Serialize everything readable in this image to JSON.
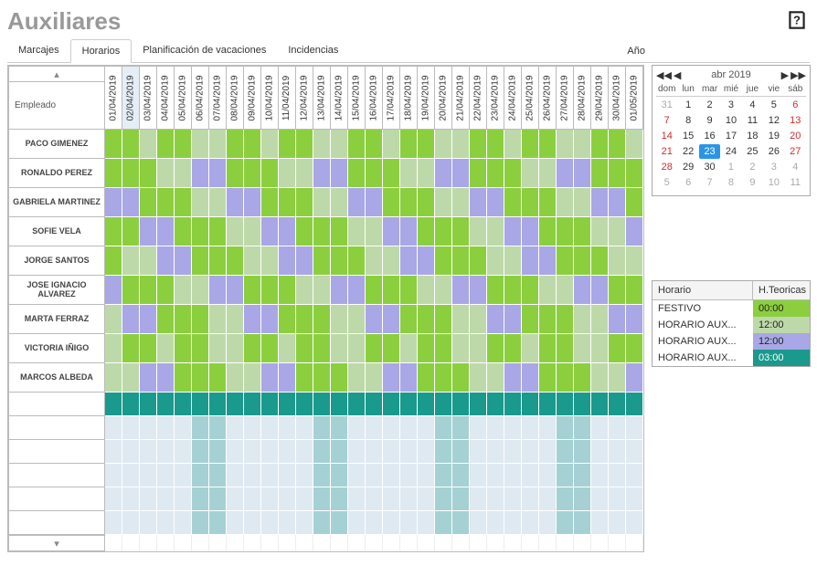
{
  "title": "Auxiliares",
  "year_label": "Año",
  "tabs": [
    "Marcajes",
    "Horarios",
    "Planificación de vacaciones",
    "Incidencias"
  ],
  "active_tab": 1,
  "employee_header": "Empleado",
  "dates": [
    "01/04/2019",
    "02/04/2019",
    "03/04/2019",
    "04/04/2019",
    "05/04/2019",
    "06/04/2019",
    "07/04/2019",
    "08/04/2019",
    "09/04/2019",
    "10/04/2019",
    "11/04/2019",
    "12/04/2019",
    "13/04/2019",
    "14/04/2019",
    "15/04/2019",
    "16/04/2019",
    "17/04/2019",
    "18/04/2019",
    "19/04/2019",
    "20/04/2019",
    "21/04/2019",
    "22/04/2019",
    "23/04/2019",
    "24/04/2019",
    "25/04/2019",
    "26/04/2019",
    "27/04/2019",
    "28/04/2019",
    "29/04/2019",
    "30/04/2019",
    "01/05/2019"
  ],
  "today_index": 1,
  "employees": [
    {
      "name": "PACO GIMENEZ",
      "cells": [
        "g",
        "g",
        "l",
        "g",
        "g",
        "l",
        "l",
        "g",
        "g",
        "l",
        "g",
        "g",
        "l",
        "l",
        "g",
        "g",
        "l",
        "g",
        "g",
        "l",
        "l",
        "g",
        "g",
        "l",
        "g",
        "g",
        "l",
        "l",
        "g",
        "g",
        "l"
      ]
    },
    {
      "name": "RONALDO PEREZ",
      "cells": [
        "g",
        "g",
        "g",
        "l",
        "l",
        "p",
        "p",
        "g",
        "g",
        "g",
        "l",
        "l",
        "p",
        "p",
        "g",
        "g",
        "g",
        "l",
        "l",
        "p",
        "p",
        "g",
        "g",
        "g",
        "l",
        "l",
        "p",
        "p",
        "g",
        "g",
        "g"
      ]
    },
    {
      "name": "GABRIELA MARTINEZ",
      "cells": [
        "p",
        "p",
        "g",
        "g",
        "g",
        "l",
        "l",
        "p",
        "p",
        "g",
        "g",
        "g",
        "l",
        "l",
        "p",
        "p",
        "g",
        "g",
        "g",
        "l",
        "l",
        "p",
        "p",
        "g",
        "g",
        "g",
        "l",
        "l",
        "p",
        "p",
        "g"
      ]
    },
    {
      "name": "SOFIE VELA",
      "cells": [
        "g",
        "g",
        "p",
        "p",
        "g",
        "g",
        "g",
        "l",
        "l",
        "p",
        "p",
        "g",
        "g",
        "g",
        "l",
        "l",
        "p",
        "p",
        "g",
        "g",
        "g",
        "l",
        "l",
        "p",
        "p",
        "g",
        "g",
        "g",
        "l",
        "l",
        "p"
      ]
    },
    {
      "name": "JORGE SANTOS",
      "cells": [
        "g",
        "l",
        "l",
        "p",
        "p",
        "g",
        "g",
        "g",
        "l",
        "l",
        "p",
        "p",
        "g",
        "g",
        "g",
        "l",
        "l",
        "p",
        "p",
        "g",
        "g",
        "g",
        "l",
        "l",
        "p",
        "p",
        "g",
        "g",
        "g",
        "l",
        "l"
      ]
    },
    {
      "name": "JOSE IGNACIO ALVAREZ",
      "cells": [
        "p",
        "g",
        "g",
        "g",
        "l",
        "l",
        "p",
        "p",
        "g",
        "g",
        "g",
        "l",
        "l",
        "p",
        "p",
        "g",
        "g",
        "g",
        "l",
        "l",
        "p",
        "p",
        "g",
        "g",
        "g",
        "l",
        "l",
        "p",
        "p",
        "g",
        "g"
      ]
    },
    {
      "name": "MARTA FERRAZ",
      "cells": [
        "l",
        "p",
        "p",
        "g",
        "g",
        "g",
        "l",
        "l",
        "p",
        "p",
        "g",
        "g",
        "g",
        "l",
        "l",
        "p",
        "p",
        "g",
        "g",
        "g",
        "l",
        "l",
        "p",
        "p",
        "g",
        "g",
        "g",
        "l",
        "l",
        "p",
        "p"
      ]
    },
    {
      "name": "VICTORIA IÑIGO",
      "cells": [
        "l",
        "g",
        "g",
        "l",
        "g",
        "g",
        "l",
        "l",
        "g",
        "g",
        "l",
        "g",
        "g",
        "l",
        "l",
        "g",
        "g",
        "l",
        "g",
        "g",
        "l",
        "l",
        "g",
        "g",
        "l",
        "g",
        "g",
        "l",
        "l",
        "g",
        "g"
      ]
    },
    {
      "name": "MARCOS ALBEDA",
      "cells": [
        "l",
        "l",
        "p",
        "p",
        "g",
        "g",
        "g",
        "l",
        "l",
        "p",
        "p",
        "g",
        "g",
        "g",
        "l",
        "l",
        "p",
        "p",
        "g",
        "g",
        "g",
        "l",
        "l",
        "p",
        "p",
        "g",
        "g",
        "g",
        "l",
        "l",
        "p"
      ]
    }
  ],
  "teal_row": true,
  "blue_band_rows": 5,
  "calendar": {
    "title": "abr 2019",
    "weekdays": [
      "dom",
      "lun",
      "mar",
      "mié",
      "jue",
      "vie",
      "sáb"
    ],
    "weeks": [
      [
        {
          "d": "31",
          "cls": "gray"
        },
        {
          "d": "1"
        },
        {
          "d": "2"
        },
        {
          "d": "3"
        },
        {
          "d": "4"
        },
        {
          "d": "5"
        },
        {
          "d": "6",
          "cls": "red"
        }
      ],
      [
        {
          "d": "7",
          "cls": "red"
        },
        {
          "d": "8"
        },
        {
          "d": "9"
        },
        {
          "d": "10"
        },
        {
          "d": "11"
        },
        {
          "d": "12"
        },
        {
          "d": "13",
          "cls": "red"
        }
      ],
      [
        {
          "d": "14",
          "cls": "red"
        },
        {
          "d": "15"
        },
        {
          "d": "16"
        },
        {
          "d": "17"
        },
        {
          "d": "18"
        },
        {
          "d": "19"
        },
        {
          "d": "20",
          "cls": "red"
        }
      ],
      [
        {
          "d": "21",
          "cls": "red"
        },
        {
          "d": "22"
        },
        {
          "d": "23",
          "cls": "sel"
        },
        {
          "d": "24"
        },
        {
          "d": "25"
        },
        {
          "d": "26"
        },
        {
          "d": "27",
          "cls": "red"
        }
      ],
      [
        {
          "d": "28",
          "cls": "red"
        },
        {
          "d": "29"
        },
        {
          "d": "30"
        },
        {
          "d": "1",
          "cls": "gray"
        },
        {
          "d": "2",
          "cls": "gray"
        },
        {
          "d": "3",
          "cls": "gray"
        },
        {
          "d": "4",
          "cls": "gray"
        }
      ],
      [
        {
          "d": "5",
          "cls": "gray"
        },
        {
          "d": "6",
          "cls": "gray"
        },
        {
          "d": "7",
          "cls": "gray"
        },
        {
          "d": "8",
          "cls": "gray"
        },
        {
          "d": "9",
          "cls": "gray"
        },
        {
          "d": "10",
          "cls": "gray"
        },
        {
          "d": "11",
          "cls": "gray"
        }
      ]
    ]
  },
  "legend": {
    "col1": "Horario",
    "col2": "H.Teoricas",
    "rows": [
      {
        "name": "FESTIVO",
        "value": "00:00",
        "color": "#8bcf3e"
      },
      {
        "name": "HORARIO AUX...",
        "value": "12:00",
        "color": "#bdd9a9"
      },
      {
        "name": "HORARIO AUX...",
        "value": "12:00",
        "color": "#a9a7e6"
      },
      {
        "name": "HORARIO AUX...",
        "value": "03:00",
        "color": "#1a998d"
      }
    ]
  }
}
